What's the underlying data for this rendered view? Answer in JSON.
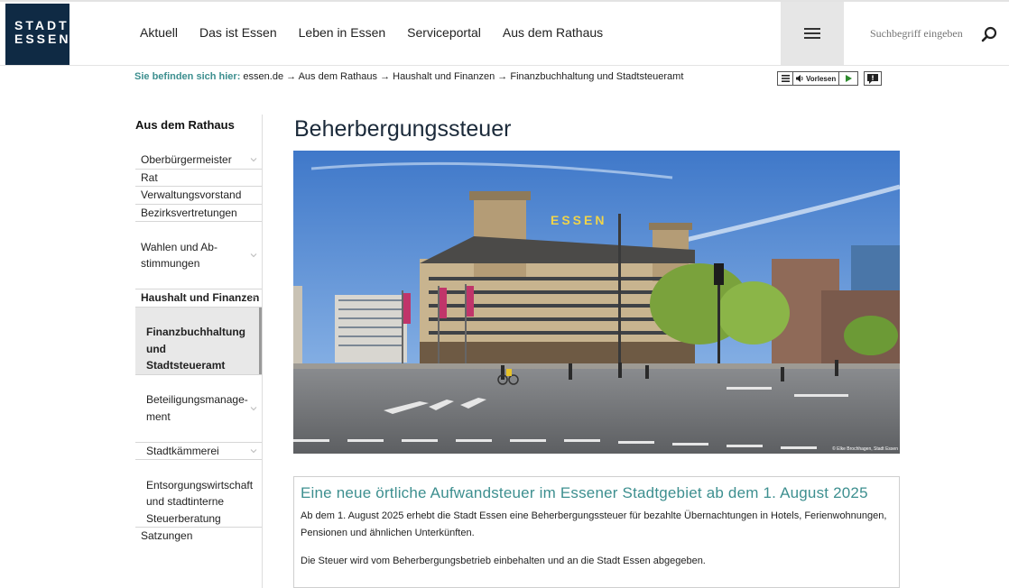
{
  "header": {
    "logo_line1": "STADT",
    "logo_line2": "ESSEN",
    "nav": [
      "Aktuell",
      "Das ist Essen",
      "Leben in Essen",
      "Serviceportal",
      "Aus dem Rathaus"
    ],
    "search_placeholder": "Suchbegriff eingeben"
  },
  "breadcrumb": {
    "label": "Sie befinden sich hier:",
    "path": "essen.de → Aus dem Rathaus → Haushalt und Finanzen → Finanzbuchhaltung und Stadtsteueramt"
  },
  "tools": {
    "read_label": "Vorlesen"
  },
  "sidebar": {
    "title": "Aus dem Rathaus",
    "items": [
      {
        "label": "Oberbürgermeister"
      },
      {
        "label": "Rat"
      },
      {
        "label": "Verwaltungsvorstand"
      },
      {
        "label": "Bezirksvertretungen"
      },
      {
        "label": "Wahlen und Ab-\nstimmungen"
      },
      {
        "label": "Haushalt und Finanzen"
      },
      {
        "label": "Finanzbuchhaltung und\nStadtsteueramt"
      },
      {
        "label": "Beteiligungsmanage-\nment"
      },
      {
        "label": "Stadtkämmerei"
      },
      {
        "label": "Entsorgungswirtschaft\nund stadtinterne\nSteuerberatung"
      },
      {
        "label": "Satzungen"
      }
    ]
  },
  "main": {
    "title": "Beherbergungssteuer",
    "image_credit": "© Elke Brochhagen, Stadt Essen",
    "sign_text": "ESSEN",
    "info_heading": "Eine neue örtliche Aufwandsteuer im Essener Stadtgebiet ab dem 1. August 2025",
    "info_p1": "Ab dem 1. August 2025 erhebt die Stadt Essen eine Beherbergungssteuer für bezahlte Übernachtungen in Hotels, Ferienwohnungen, Pensionen und ähnlichen Unterkünften.",
    "info_p2": "Die Steuer wird vom Beherbergungsbetrieb einbehalten und an die Stadt Essen abgegeben."
  },
  "colors": {
    "logo_bg": "#0f2a44",
    "accent": "#3d8f8f",
    "active_bg": "#e8e8e8"
  }
}
